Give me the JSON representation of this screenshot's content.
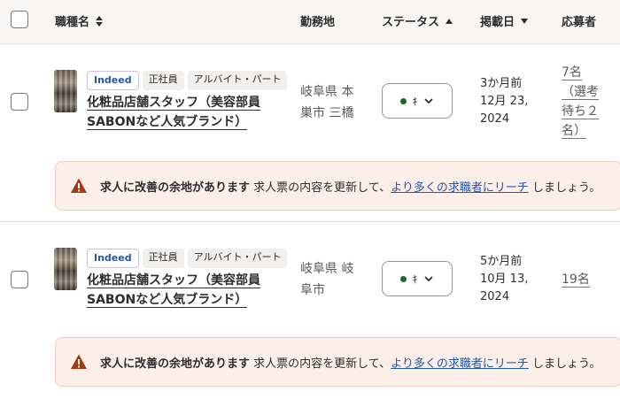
{
  "header": {
    "job_title": "職種名",
    "location": "勤務地",
    "status": "ステータス",
    "posted": "掲載日",
    "applicants": "応募者"
  },
  "rows": [
    {
      "badges": [
        "Indeed",
        "正社員",
        "アルバイト・パート"
      ],
      "title_line1": "化粧品店舗スタッフ（美容部員",
      "title_line2": "SABONなど人気ブランド）",
      "location_line1": "岐阜県 本",
      "location_line2": "巣市 三橋",
      "status_glyph": "ｷ",
      "date_line1": "3か月前",
      "date_line2": "12月 23,",
      "date_line3": "2024",
      "applicants_line1": "7名",
      "applicants_line2": "（選考",
      "applicants_line3": "待ち２",
      "applicants_line4": "名）"
    },
    {
      "badges": [
        "Indeed",
        "正社員",
        "アルバイト・パート"
      ],
      "title_line1": "化粧品店舗スタッフ（美容部員",
      "title_line2": "SABONなど人気ブランド）",
      "location_line1": "岐阜県 岐",
      "location_line2": "阜市",
      "status_glyph": "ｷ",
      "date_line1": "5か月前",
      "date_line2": "10月 13,",
      "date_line3": "2024",
      "applicants_line1": "19名"
    }
  ],
  "notice": {
    "bold": "求人に改善の余地があります",
    "text": "求人票の内容を更新して、",
    "link": "より多くの求職者にリーチ",
    "suffix": "しましょう。"
  },
  "colors": {
    "header_bg": "#f7f6f4",
    "notice_bg": "#fcefe9",
    "warning_icon": "#a13b15",
    "status_dot": "#1f662c",
    "link": "#2557a7"
  },
  "icons": {
    "sort_both": "sort-both-icon",
    "sort_up": "caret-up-icon",
    "sort_down": "caret-down-icon",
    "warning": "warning-triangle-icon",
    "chevron": "chevron-down-icon"
  }
}
